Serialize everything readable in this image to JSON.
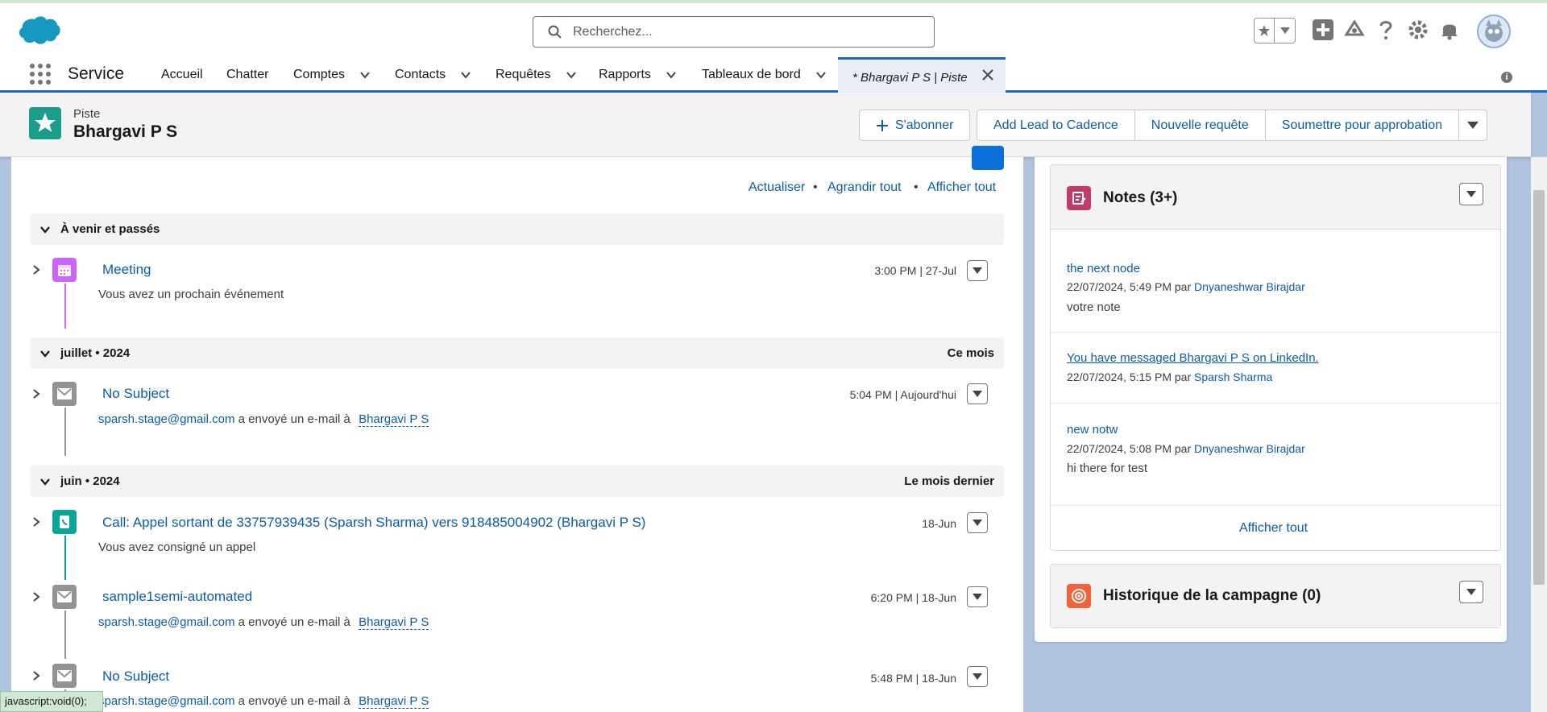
{
  "search": {
    "placeholder": "Recherchez..."
  },
  "app": {
    "name": "Service"
  },
  "nav": {
    "items": [
      {
        "label": "Accueil"
      },
      {
        "label": "Chatter"
      },
      {
        "label": "Comptes"
      },
      {
        "label": "Contacts"
      },
      {
        "label": "Requêtes"
      },
      {
        "label": "Rapports"
      },
      {
        "label": "Tableaux de bord"
      }
    ],
    "active_tab": "* Bhargavi P S | Piste"
  },
  "record": {
    "type": "Piste",
    "name": "Bhargavi P S",
    "actions": {
      "subscribe": "S'abonner",
      "add_cadence": "Add Lead to Cadence",
      "new_case": "Nouvelle requête",
      "submit_approval": "Soumettre pour approbation"
    }
  },
  "activity": {
    "links": {
      "refresh": "Actualiser",
      "expand_all": "Agrandir tout",
      "view_all": "Afficher tout"
    },
    "sections": [
      {
        "title": "À venir et passés",
        "right": ""
      },
      {
        "title": "juillet • 2024",
        "right": "Ce mois"
      },
      {
        "title": "juin • 2024",
        "right": "Le mois dernier"
      }
    ],
    "items": [
      {
        "title": "Meeting",
        "date": "3:00 PM | 27-Jul",
        "sub": "Vous avez un prochain événement"
      },
      {
        "title": "No Subject",
        "date": "5:04 PM | Aujourd'hui",
        "sender": "sparsh.stage@gmail.com",
        "mid": "a envoyé un e-mail à",
        "recipient": "Bhargavi P S"
      },
      {
        "title": "Call: Appel sortant de 33757939435 (Sparsh Sharma) vers 918485004902 (Bhargavi P S)",
        "date": "18-Jun",
        "sub": "Vous avez consigné un appel"
      },
      {
        "title": "sample1semi-automated",
        "date": "6:20 PM | 18-Jun",
        "sender": "sparsh.stage@gmail.com",
        "mid": "a envoyé un e-mail à",
        "recipient": "Bhargavi P S"
      },
      {
        "title": "No Subject",
        "date": "5:48 PM | 18-Jun",
        "sender": "sparsh.stage@gmail.com",
        "mid": "a envoyé un e-mail à",
        "recipient": "Bhargavi P S"
      }
    ]
  },
  "notes": {
    "title": "Notes (3+)",
    "items": [
      {
        "title": "the next node",
        "meta": "22/07/2024, 5:49 PM par",
        "author": "Dnyaneshwar Birajdar",
        "body": "votre note"
      },
      {
        "title": "You have messaged Bhargavi P S on LinkedIn.",
        "meta": "22/07/2024, 5:15 PM par",
        "author": "Sparsh Sharma",
        "body": ""
      },
      {
        "title": "new notw",
        "meta": "22/07/2024, 5:08 PM par",
        "author": "Dnyaneshwar Birajdar",
        "body": "hi there for test"
      }
    ],
    "view_all": "Afficher tout"
  },
  "campaign": {
    "title": "Historique de la campagne (0)"
  },
  "statusbar": {
    "text": "javascript:void(0);"
  },
  "colors": {
    "brand": "#1b6ac9",
    "link": "#0b5cab",
    "lead_icon": "#1a9e8b",
    "event": "#cb65ff",
    "call": "#06a59a",
    "email": "#939393",
    "notes": "#c23a6a",
    "campaign": "#f4623a"
  }
}
